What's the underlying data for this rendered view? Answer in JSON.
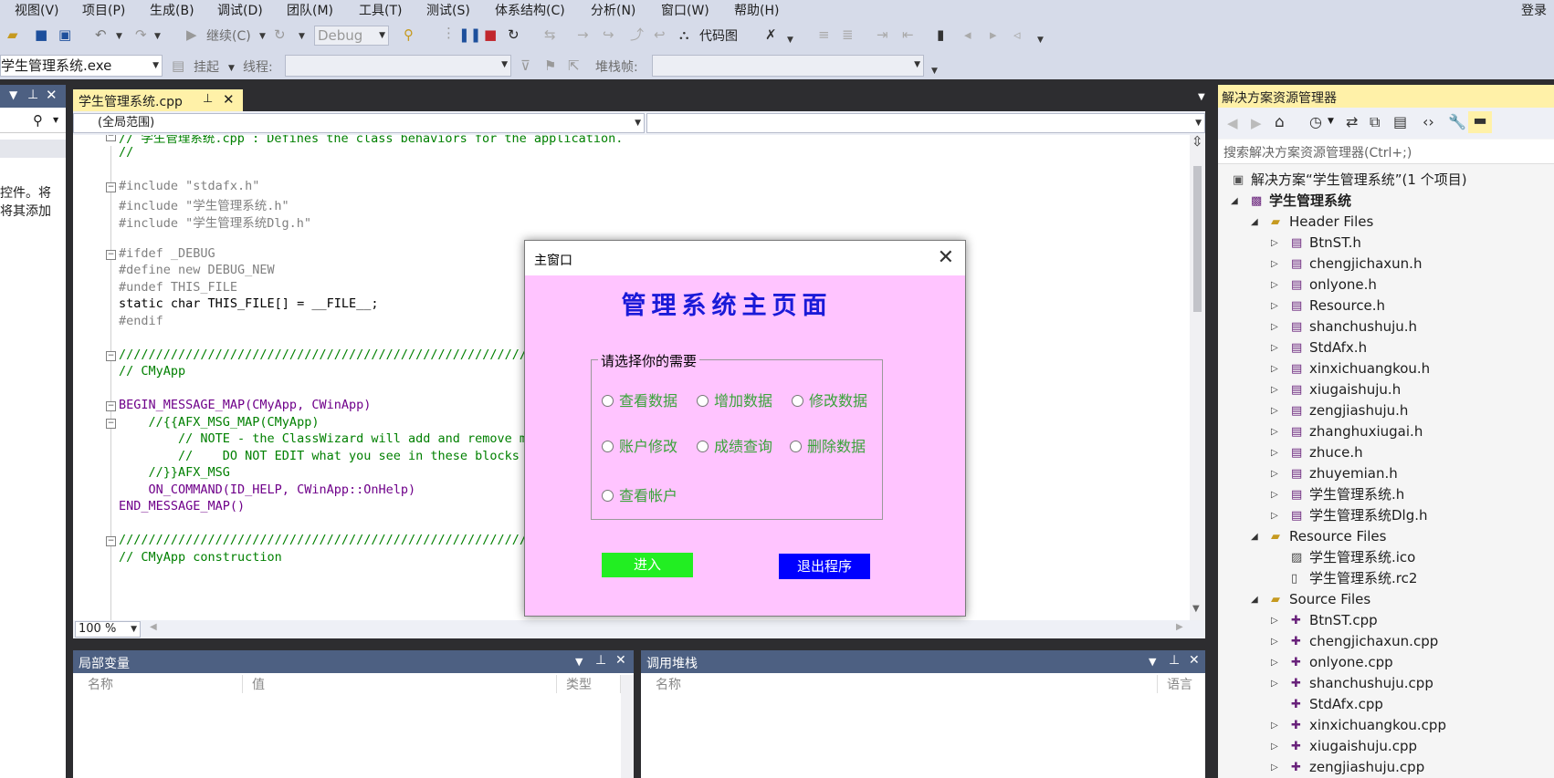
{
  "menu": [
    "视图(V)",
    "项目(P)",
    "生成(B)",
    "调试(D)",
    "团队(M)",
    "工具(T)",
    "测试(S)",
    "体系结构(C)",
    "分析(N)",
    "窗口(W)",
    "帮助(H)"
  ],
  "login": "登录",
  "toolbar1": {
    "continue": "继续(C)",
    "config": "Debug",
    "codemap": "代码图"
  },
  "toolbar2": {
    "process": "学生管理系统.exe",
    "suspend": "挂起",
    "thread": "线程:",
    "stackframe": "堆栈帧:"
  },
  "leftpanel": {
    "text1": "控件。将",
    "text2": "将其添加"
  },
  "editor": {
    "tab": "学生管理系统.cpp",
    "scope": "(全局范围)",
    "zoom": "100 %",
    "lines": [
      "// 学生管理系统.cpp : Defines the class behaviors for the application.",
      "//",
      "",
      "#include \"stdafx.h\"",
      "#include \"学生管理系统.h\"",
      "#include \"学生管理系统Dlg.h\"",
      "",
      "#ifdef _DEBUG",
      "#define new DEBUG_NEW",
      "#undef THIS_FILE",
      "static char THIS_FILE[] = __FILE__;",
      "#endif",
      "",
      "/////////////////////////////////////////////////////////",
      "// CMyApp",
      "",
      "BEGIN_MESSAGE_MAP(CMyApp, CWinApp)",
      "    //{{AFX_MSG_MAP(CMyApp)",
      "        // NOTE - the ClassWizard will add and remove ma",
      "        //    DO NOT EDIT what you see in these blocks o",
      "    //}}AFX_MSG",
      "    ON_COMMAND(ID_HELP, CWinApp::OnHelp)",
      "END_MESSAGE_MAP()",
      "",
      "/////////////////////////////////////////////////////////",
      "// CMyApp construction"
    ]
  },
  "locals": {
    "title": "局部变量",
    "cols": [
      "名称",
      "值",
      "类型"
    ]
  },
  "callstack": {
    "title": "调用堆栈",
    "cols": [
      "名称",
      "语言"
    ]
  },
  "solution": {
    "title": "解决方案资源管理器",
    "search": "搜索解决方案资源管理器(Ctrl+;)",
    "root": "解决方案“学生管理系统”(1 个项目)",
    "project": "学生管理系统",
    "header_folder": "Header Files",
    "headers": [
      "BtnST.h",
      "chengjichaxun.h",
      "onlyone.h",
      "Resource.h",
      "shanchushuju.h",
      "StdAfx.h",
      "xinxichuangkou.h",
      "xiugaishuju.h",
      "zengjiashuju.h",
      "zhanghuxiugai.h",
      "zhuce.h",
      "zhuyemian.h",
      "学生管理系统.h",
      "学生管理系统Dlg.h"
    ],
    "resource_folder": "Resource Files",
    "resources": [
      "学生管理系统.ico",
      "学生管理系统.rc2"
    ],
    "source_folder": "Source Files",
    "sources": [
      "BtnST.cpp",
      "chengjichaxun.cpp",
      "onlyone.cpp",
      "shanchushuju.cpp",
      "StdAfx.cpp",
      "xinxichuangkou.cpp",
      "xiugaishuju.cpp",
      "zengjiashuju.cpp"
    ]
  },
  "dialog": {
    "title": "主窗口",
    "heading": "管理系统主页面",
    "group_label": "请选择你的需要",
    "options": [
      "查看数据",
      "增加数据",
      "修改数据",
      "账户修改",
      "成绩查询",
      "删除数据",
      "查看帐户"
    ],
    "enter": "进入",
    "exit": "退出程序"
  }
}
